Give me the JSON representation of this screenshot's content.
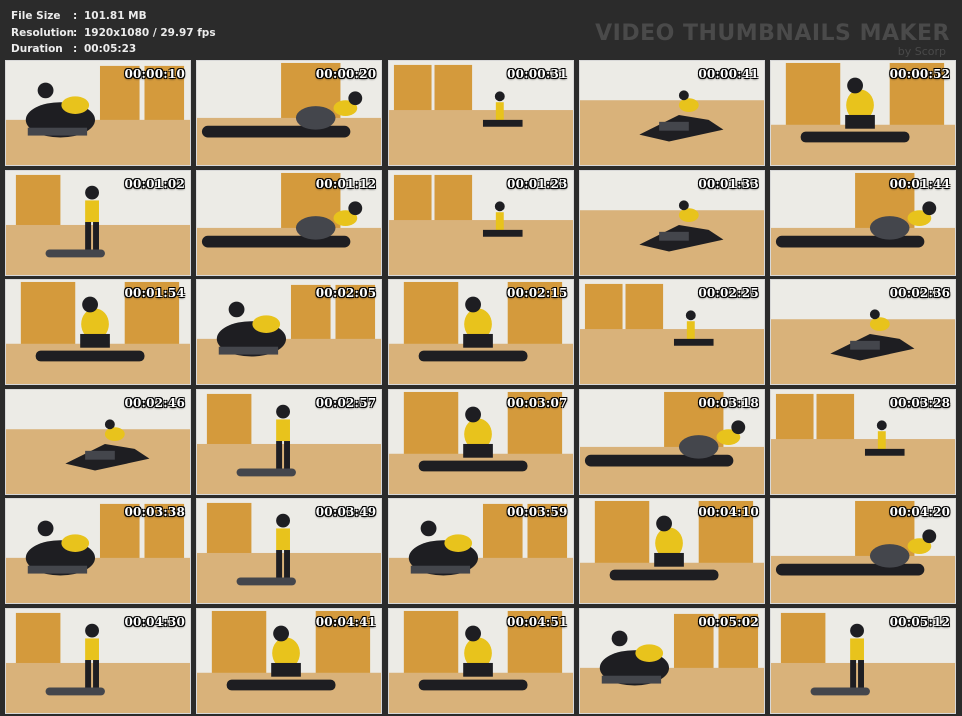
{
  "info": {
    "file_size_label": "File Size",
    "file_size_value": "101.81 MB",
    "resolution_label": "Resolution",
    "resolution_value": "1920x1080 / 29.97 fps",
    "duration_label": "Duration",
    "duration_value": "00:05:23",
    "separator": ":"
  },
  "brand": {
    "title": "VIDEO THUMBNAILS MAKER",
    "subtitle": "by Scorp"
  },
  "colors": {
    "background": "#2b2b2b",
    "floor": "#d9b27a",
    "wall": "#ecebe6",
    "door": "#d49a3c",
    "figure_dark": "#1e1e22",
    "accent_yellow": "#e8c31c"
  },
  "thumbnails": [
    {
      "timestamp": "00:00:10",
      "scene": 0
    },
    {
      "timestamp": "00:00:20",
      "scene": 1
    },
    {
      "timestamp": "00:00:31",
      "scene": 2
    },
    {
      "timestamp": "00:00:41",
      "scene": 3
    },
    {
      "timestamp": "00:00:52",
      "scene": 4
    },
    {
      "timestamp": "00:01:02",
      "scene": 5
    },
    {
      "timestamp": "00:01:12",
      "scene": 1
    },
    {
      "timestamp": "00:01:23",
      "scene": 2
    },
    {
      "timestamp": "00:01:33",
      "scene": 3
    },
    {
      "timestamp": "00:01:44",
      "scene": 1
    },
    {
      "timestamp": "00:01:54",
      "scene": 4
    },
    {
      "timestamp": "00:02:05",
      "scene": 0
    },
    {
      "timestamp": "00:02:15",
      "scene": 4
    },
    {
      "timestamp": "00:02:25",
      "scene": 2
    },
    {
      "timestamp": "00:02:36",
      "scene": 3
    },
    {
      "timestamp": "00:02:46",
      "scene": 3
    },
    {
      "timestamp": "00:02:57",
      "scene": 5
    },
    {
      "timestamp": "00:03:07",
      "scene": 4
    },
    {
      "timestamp": "00:03:18",
      "scene": 1
    },
    {
      "timestamp": "00:03:28",
      "scene": 2
    },
    {
      "timestamp": "00:03:38",
      "scene": 0
    },
    {
      "timestamp": "00:03:49",
      "scene": 5
    },
    {
      "timestamp": "00:03:59",
      "scene": 0
    },
    {
      "timestamp": "00:04:10",
      "scene": 4
    },
    {
      "timestamp": "00:04:20",
      "scene": 1
    },
    {
      "timestamp": "00:04:30",
      "scene": 5
    },
    {
      "timestamp": "00:04:41",
      "scene": 4
    },
    {
      "timestamp": "00:04:51",
      "scene": 4
    },
    {
      "timestamp": "00:05:02",
      "scene": 0
    },
    {
      "timestamp": "00:05:12",
      "scene": 5
    }
  ]
}
